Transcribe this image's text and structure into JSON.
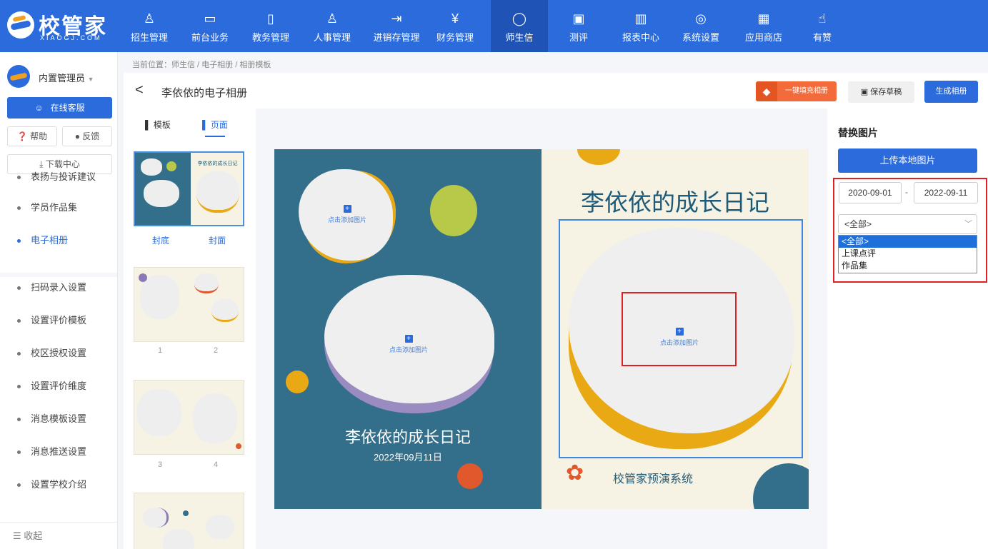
{
  "brand": {
    "name": "校管家",
    "sub": "XIAOGJ.COM"
  },
  "topnav": [
    {
      "label": "招生管理",
      "icon": "user-add-icon"
    },
    {
      "label": "前台业务",
      "icon": "desk-icon"
    },
    {
      "label": "教务管理",
      "icon": "book-icon"
    },
    {
      "label": "人事管理",
      "icon": "person-icon"
    },
    {
      "label": "进销存管理",
      "icon": "inventory-icon"
    },
    {
      "label": "财务管理",
      "icon": "yuan-icon"
    },
    {
      "label": "师生信",
      "icon": "chat-icon",
      "active": true
    },
    {
      "label": "测评",
      "icon": "clipboard-icon"
    },
    {
      "label": "报表中心",
      "icon": "bar-chart-icon"
    },
    {
      "label": "系统设置",
      "icon": "settings-icon"
    },
    {
      "label": "应用商店",
      "icon": "apps-icon"
    },
    {
      "label": "有赞",
      "icon": "thumbs-up-icon"
    }
  ],
  "sidebar": {
    "user": "内置管理员",
    "online_service": "在线客服",
    "help": "帮助",
    "feedback": "反馈",
    "download": "下载中心",
    "items": [
      {
        "label": "表扬与投诉建议"
      },
      {
        "label": "学员作品集"
      },
      {
        "label": "电子相册",
        "active": true
      },
      {
        "label": "扫码录入设置"
      },
      {
        "label": "设置评价模板"
      },
      {
        "label": "校区授权设置"
      },
      {
        "label": "设置评价维度"
      },
      {
        "label": "消息模板设置"
      },
      {
        "label": "消息推送设置"
      },
      {
        "label": "设置学校介绍"
      }
    ],
    "collapse": "收起"
  },
  "breadcrumb": "当前位置：师生信 / 电子相册 / 相册模板",
  "toolbar": {
    "title": "李依依的电子相册",
    "fill_all": "一键填充相册",
    "save_draft": "保存草稿",
    "generate": "生成相册"
  },
  "panel_tabs": {
    "template": "模板",
    "page": "页面"
  },
  "thumbnails": [
    {
      "left": "封底",
      "right": "封面",
      "title": "李依依的成长日记"
    },
    {
      "left": "1",
      "right": "2"
    },
    {
      "left": "3",
      "right": "4"
    }
  ],
  "spread": {
    "add_photo": "点击添加图片",
    "cover_title": "李依依的成长日记",
    "cover_date": "2022年09月11日",
    "back_title": "李依依的成长日记",
    "footer": "校管家预演系统"
  },
  "replace_panel": {
    "title": "替换图片",
    "upload": "上传本地图片",
    "date_from": "2020-09-01",
    "date_to": "2022-09-11",
    "separator": "-",
    "category_selected": "<全部>",
    "category_options": [
      "<全部>",
      "上课点评",
      "作品集"
    ]
  },
  "colors": {
    "primary": "#2b6bdc",
    "cover_blue": "#336f8a",
    "cream": "#f6f3e4",
    "accent_orange": "#f36b3b",
    "accent_yellow": "#e8a915",
    "alert_red": "#e02020"
  }
}
